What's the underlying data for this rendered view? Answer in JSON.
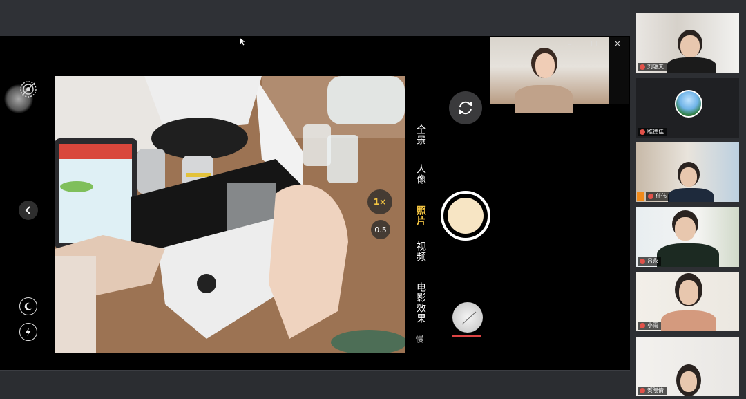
{
  "camera": {
    "modes": [
      "全景",
      "人像",
      "照片",
      "视频",
      "电影效果",
      "慢"
    ],
    "active_mode": "照片",
    "zoom_options": [
      "1×",
      "0.5"
    ],
    "active_zoom": "1×"
  },
  "presenter_window": {
    "controls": [
      "–",
      "☐",
      "✕"
    ]
  },
  "participants": [
    {
      "name": "刘融天"
    },
    {
      "name": "睢德佳"
    },
    {
      "name": "任伟"
    },
    {
      "name": "吕永"
    },
    {
      "name": "小雨"
    },
    {
      "name": "贺晓倩"
    }
  ],
  "colors": {
    "accent": "#f4c542",
    "name_dot": "#e2524a",
    "host_badge": "#f08a1a"
  },
  "icons": {
    "back": "chevron-left-icon",
    "switch_camera": "camera-switch-icon",
    "night_mode": "moon-icon",
    "flash": "flash-icon",
    "live": "live-photo-icon"
  }
}
